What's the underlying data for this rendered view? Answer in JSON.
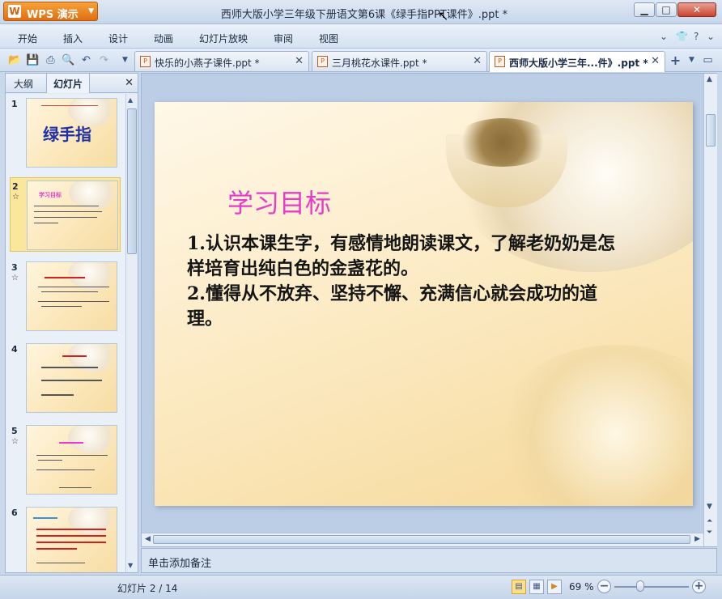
{
  "app": {
    "name": "WPS 演示",
    "window_title": "西师大版小学三年级下册语文第6课《绿手指PPT课件》.ppt *"
  },
  "window_controls": {
    "minimize": "▁",
    "maximize": "□",
    "close": "✕"
  },
  "menu": {
    "items": [
      "开始",
      "插入",
      "设计",
      "动画",
      "幻灯片放映",
      "审阅",
      "视图"
    ]
  },
  "toolbar": {
    "icons": [
      "open-icon",
      "save-icon",
      "print-icon",
      "print-preview-icon",
      "undo-icon",
      "redo-icon",
      "dropdown-icon"
    ]
  },
  "doc_tabs": [
    {
      "label": "快乐的小燕子课件.ppt *",
      "active": false
    },
    {
      "label": "三月桃花水课件.ppt *",
      "active": false
    },
    {
      "label": "西师大版小学三年...件》.ppt *",
      "active": true
    }
  ],
  "left_panel": {
    "tab_outline": "大纲",
    "tab_slides": "幻灯片",
    "close": "✕",
    "thumbnails": [
      {
        "num": "1",
        "title": "绿手指",
        "title_color": "#1f2fa6",
        "star": false
      },
      {
        "num": "2",
        "title": "学习目标",
        "title_color": "#e83cc8",
        "star": true
      },
      {
        "num": "3",
        "title": "",
        "title_color": "#d02020",
        "star": true
      },
      {
        "num": "4",
        "title": "",
        "title_color": "#d02020",
        "star": false
      },
      {
        "num": "5",
        "title": "",
        "title_color": "#e83cc8",
        "star": true
      },
      {
        "num": "6",
        "title": "",
        "title_color": "#d02020",
        "star": false
      }
    ]
  },
  "slide": {
    "title": "学习目标",
    "body": [
      "1.认识本课生字，有感情地朗读课文，了解老奶奶是怎样培育出纯白色的金盏花的。",
      "2.懂得从不放弃、坚持不懈、充满信心就会成功的道理。"
    ],
    "title_color": "#e83cc8"
  },
  "notes": {
    "placeholder": "单击添加备注"
  },
  "status": {
    "slide_indicator": "幻灯片 2 / 14",
    "zoom": "69 %",
    "zoom_fraction": 0.35
  }
}
